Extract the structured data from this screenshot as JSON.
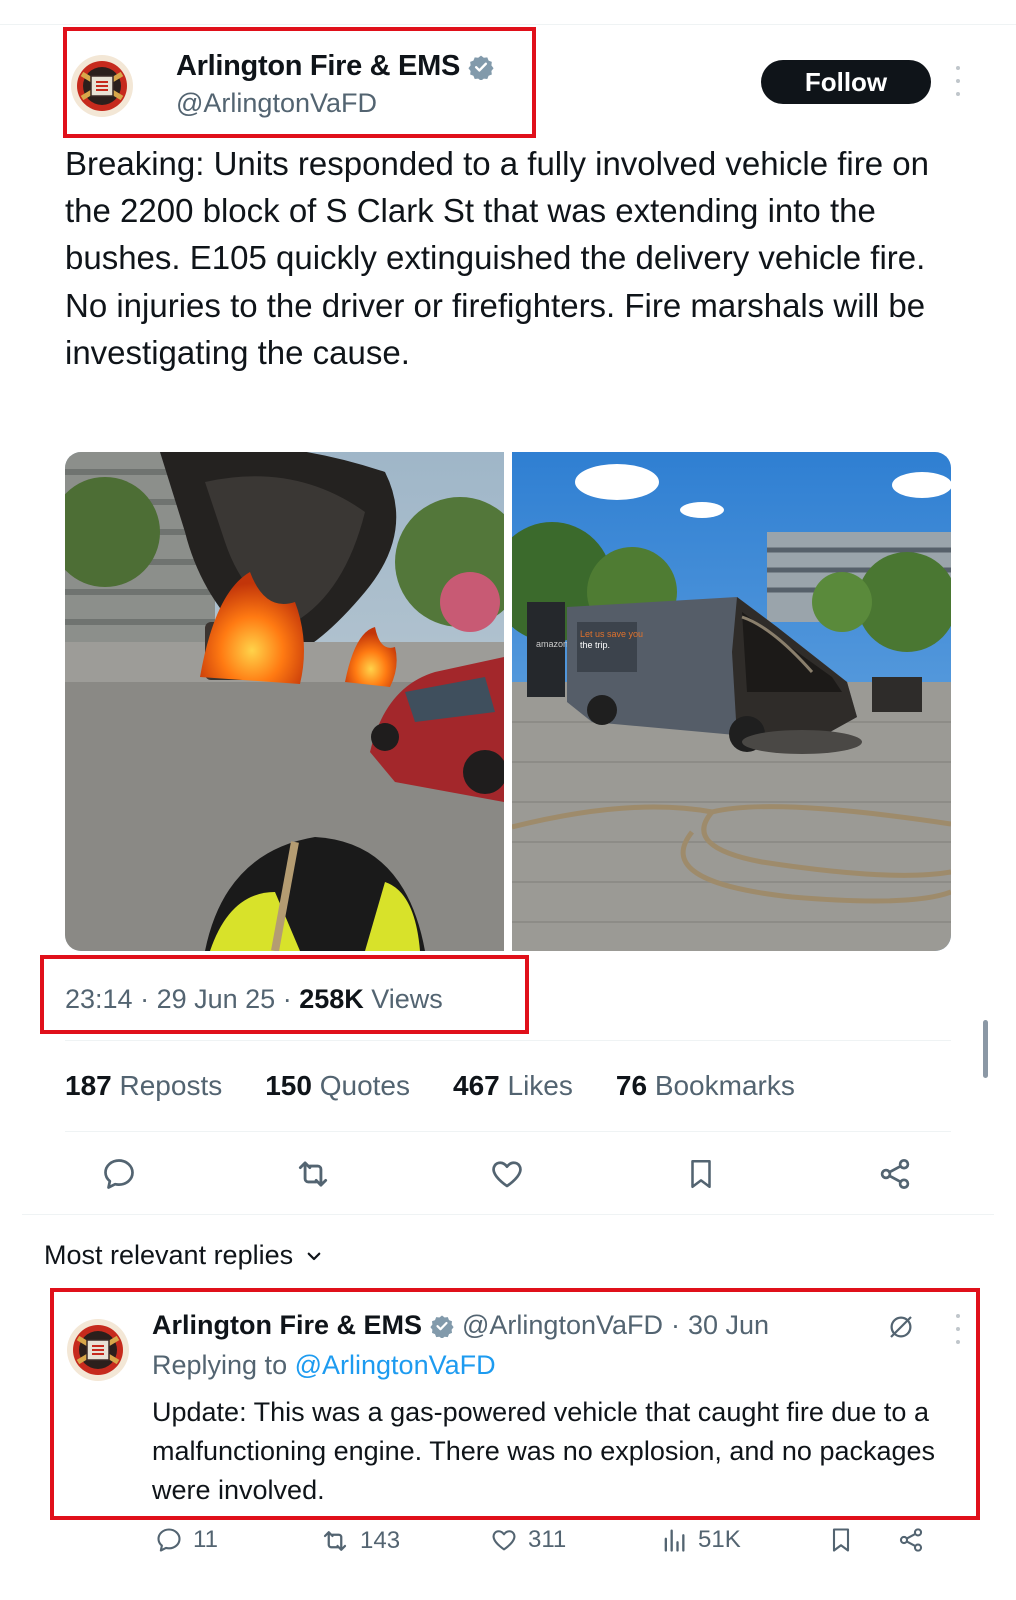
{
  "post": {
    "author_name": "Arlington Fire & EMS",
    "author_handle": "@ArlingtonVaFD",
    "follow_label": "Follow",
    "text": "Breaking: Units responded to a fully involved vehicle fire on the 2200 block of S Clark St that was extending into the bushes. E105 quickly extinguished the delivery vehicle fire. No injuries to the driver or firefighters. Fire marshals will be investigating the cause.",
    "media": [
      {
        "icon": "burning-vehicle-photo"
      },
      {
        "icon": "burned-van-photo",
        "van_text_1": "amazon",
        "van_text_2": "Let us save you",
        "van_text_3": "the trip."
      }
    ],
    "time": "23:14",
    "date": "29 Jun 25",
    "views_count": "258K",
    "views_label": "Views",
    "stats": {
      "reposts_count": "187",
      "reposts_label": "Reposts",
      "quotes_count": "150",
      "quotes_label": "Quotes",
      "likes_count": "467",
      "likes_label": "Likes",
      "bookmarks_count": "76",
      "bookmarks_label": "Bookmarks"
    }
  },
  "replies": {
    "heading": "Most relevant replies",
    "items": [
      {
        "author_name": "Arlington Fire & EMS",
        "author_handle": "@ArlingtonVaFD",
        "date": "30 Jun",
        "replying_prefix": "Replying to",
        "replying_handle": "@ArlingtonVaFD",
        "text": "Update: This was a gas-powered vehicle that caught fire due to a malfunctioning engine. There was no explosion, and no packages were involved.",
        "replies_count": "11",
        "reposts_count": "143",
        "likes_count": "311",
        "views_count": "51K"
      }
    ]
  },
  "colors": {
    "highlight_box": "#e0101a",
    "link": "#1d9bf0",
    "verified": "#829aab",
    "secondary_text": "#536471"
  }
}
